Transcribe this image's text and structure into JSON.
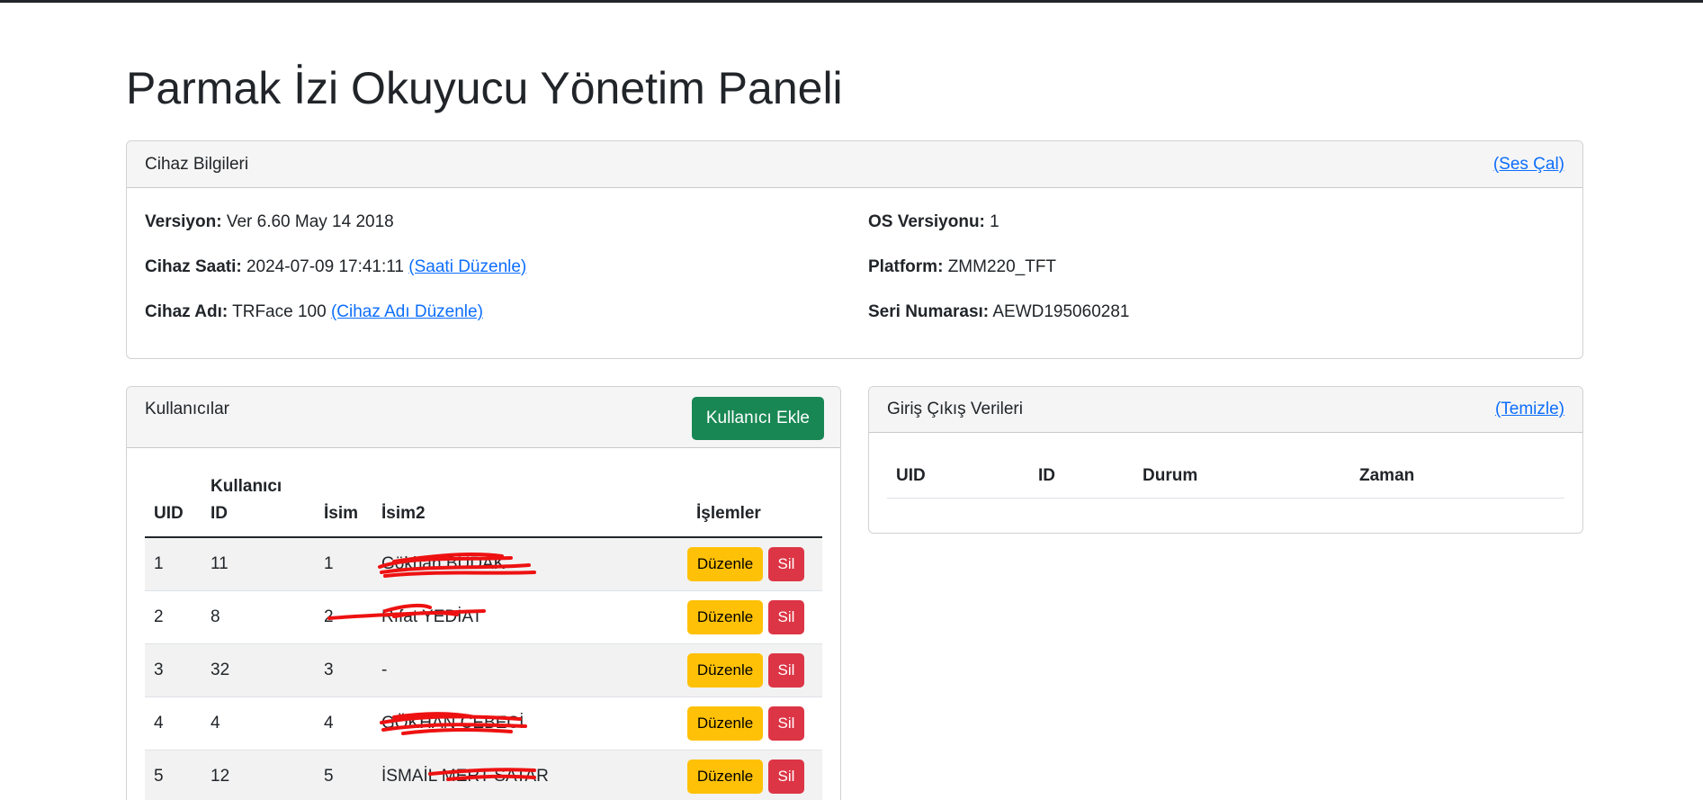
{
  "page_title": "Parmak İzi Okuyucu Yönetim Paneli",
  "device_card": {
    "title": "Cihaz Bilgileri",
    "action_link": "(Ses Çal)",
    "left": [
      {
        "label": "Versiyon:",
        "value": "Ver 6.60 May 14 2018",
        "link": ""
      },
      {
        "label": "Cihaz Saati:",
        "value": "2024-07-09 17:41:11",
        "link": "(Saati Düzenle)"
      },
      {
        "label": "Cihaz Adı:",
        "value": "TRFace 100",
        "link": "(Cihaz Adı Düzenle)"
      }
    ],
    "right": [
      {
        "label": "OS Versiyonu:",
        "value": "1"
      },
      {
        "label": "Platform:",
        "value": "ZMM220_TFT"
      },
      {
        "label": "Seri Numarası:",
        "value": "AEWD195060281"
      }
    ]
  },
  "users_card": {
    "title": "Kullanıcılar",
    "add_button": "Kullanıcı Ekle",
    "columns": [
      "UID",
      "Kullanıcı ID",
      "İsim",
      "İsim2",
      "İşlemler"
    ],
    "edit_label": "Düzenle",
    "delete_label": "Sil",
    "rows": [
      {
        "uid": "1",
        "user_id": "11",
        "name": "1",
        "name2": "Gökhan BUDAK",
        "redacted": true
      },
      {
        "uid": "2",
        "user_id": "8",
        "name": "2",
        "name2": "Rıfat YEDİAT",
        "redacted": true
      },
      {
        "uid": "3",
        "user_id": "32",
        "name": "3",
        "name2": "-",
        "redacted": false
      },
      {
        "uid": "4",
        "user_id": "4",
        "name": "4",
        "name2": "GÖKHAN CEBECİ",
        "redacted": true
      },
      {
        "uid": "5",
        "user_id": "12",
        "name": "5",
        "name2": "İSMAİL MERT SATAR",
        "redacted": true
      }
    ]
  },
  "log_card": {
    "title": "Giriş Çıkış Verileri",
    "action_link": "(Temizle)",
    "columns": [
      "UID",
      "ID",
      "Durum",
      "Zaman"
    ]
  },
  "colors": {
    "success": "#198754",
    "warning": "#ffc107",
    "danger": "#dc3545",
    "link": "#0d6efd",
    "redaction": "#ee1111"
  }
}
